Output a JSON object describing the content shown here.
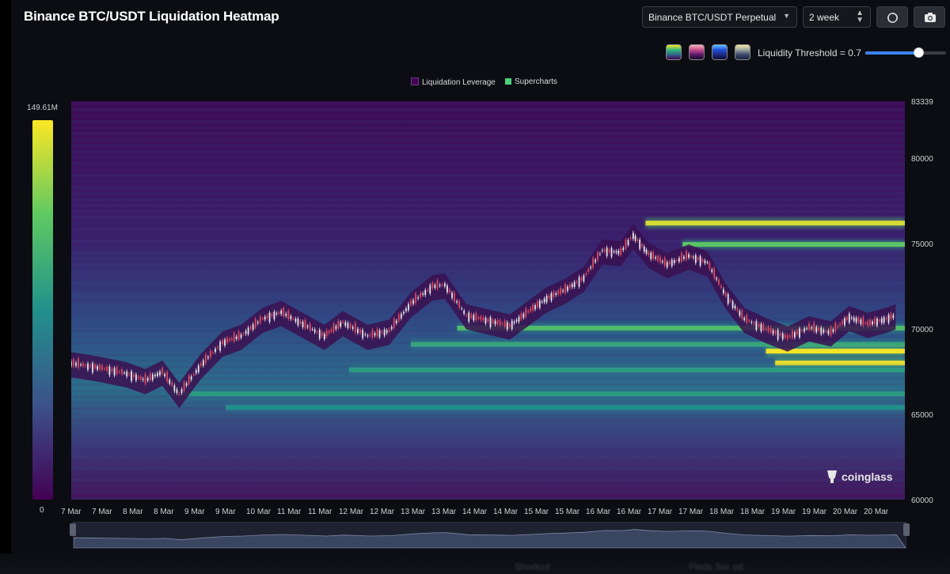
{
  "header": {
    "title": "Binance BTC/USDT Liquidation Heatmap",
    "market_select": "Binance BTC/USDT Perpetual",
    "range_select": "2 week",
    "refresh_icon": "refresh-icon",
    "camera_icon": "camera-icon"
  },
  "controls": {
    "palettes": [
      "viridis",
      "pink-purple",
      "blue",
      "beige-navy"
    ],
    "threshold_label": "Liquidity Threshold = 0.7",
    "threshold_value": 0.7
  },
  "legend": [
    {
      "label": "Liquidation Leverage",
      "color": "#440154"
    },
    {
      "label": "Supercharts",
      "color": "#4ad27a"
    }
  ],
  "colorbar": {
    "max_label": "149.61M",
    "min_label": "0"
  },
  "watermark": "coinglass",
  "bottom_text": [
    "Shortcut",
    "Pleds Sor od"
  ],
  "chart_data": {
    "type": "heatmap",
    "title": "",
    "y_axis": {
      "min": 60000,
      "max": 83339,
      "ticks": [
        83339,
        80000,
        75000,
        70000,
        65000,
        60000
      ]
    },
    "x_axis": {
      "tick_labels": [
        "7 Mar",
        "7 Mar",
        "8 Mar",
        "8 Mar",
        "9 Mar",
        "9 Mar",
        "10 Mar",
        "11 Mar",
        "11 Mar",
        "12 Mar",
        "12 Mar",
        "13 Mar",
        "13 Mar",
        "14 Mar",
        "14 Mar",
        "15 Mar",
        "15 Mar",
        "16 Mar",
        "16 Mar",
        "17 Mar",
        "17 Mar",
        "18 Mar",
        "18 Mar",
        "19 Mar",
        "19 Mar",
        "20 Mar",
        "20 Mar"
      ]
    },
    "price_series": {
      "name": "BTC/USDT",
      "x_index": [
        0,
        1,
        1.8,
        2.4,
        2.95,
        3.5,
        4.2,
        4.9,
        5.5,
        6.2,
        6.8,
        7.5,
        8.2,
        8.8,
        9.6,
        10.3,
        11.0,
        11.7,
        12.1,
        12.8,
        13.5,
        14.2,
        14.8,
        15.4,
        16.0,
        16.6,
        17.2,
        17.8,
        18.2,
        18.7,
        19.3,
        20.0,
        20.6,
        21.2,
        21.8,
        22.5,
        23.2,
        23.9,
        24.6,
        25.2,
        25.8,
        26.4,
        26.7
      ],
      "price": [
        68000,
        67700,
        67400,
        67000,
        67500,
        66200,
        67900,
        69200,
        69600,
        70600,
        71000,
        70300,
        69600,
        70400,
        69600,
        69900,
        71500,
        72500,
        72600,
        70800,
        70500,
        70200,
        71000,
        71800,
        72300,
        73000,
        74600,
        74500,
        75500,
        74400,
        73800,
        74300,
        73900,
        72000,
        70600,
        70000,
        69500,
        70100,
        69800,
        70700,
        70300,
        70600,
        70800
      ]
    },
    "liquidity_bands": [
      {
        "price": 76200,
        "intensity": 0.95,
        "from": 18.6
      },
      {
        "price": 74950,
        "intensity": 0.75,
        "from": 19.8
      },
      {
        "price": 70050,
        "intensity": 0.7,
        "from": 12.5
      },
      {
        "price": 69100,
        "intensity": 0.6,
        "from": 11.0
      },
      {
        "price": 68700,
        "intensity": 1.0,
        "from": 22.5
      },
      {
        "price": 68000,
        "intensity": 1.0,
        "from": 22.8
      },
      {
        "price": 67600,
        "intensity": 0.55,
        "from": 9.0
      },
      {
        "price": 66200,
        "intensity": 0.55,
        "from": 3.2
      },
      {
        "price": 65400,
        "intensity": 0.5,
        "from": 5.0
      }
    ],
    "colorscale": "viridis",
    "value_range": [
      0,
      149.61
    ]
  }
}
